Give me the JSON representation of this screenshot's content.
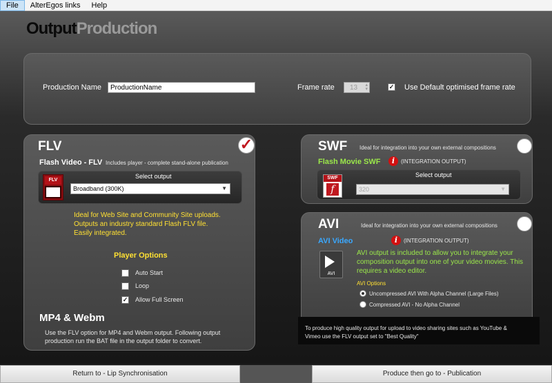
{
  "menu": {
    "items": [
      "File",
      "AlterEgos links",
      "Help"
    ]
  },
  "header": {
    "title_part1": "Output",
    "title_part2": "Production"
  },
  "top_panel": {
    "production_name_label": "Production Name",
    "production_name_value": "ProductionName",
    "frame_rate_label": "Frame rate",
    "frame_rate_value": "13",
    "use_default_label": "Use Default optimised frame rate"
  },
  "flv": {
    "title": "FLV",
    "subtitle": "Flash Video - FLV",
    "subtitle_note": "Includes player - complete stand-alone publication",
    "icon_label": "FLV",
    "select_output_label": "Select output",
    "select_output_value": "Broadband (300K)",
    "desc_line1": "Ideal for Web Site and Community Site uploads.",
    "desc_line2": "Outputs an industry standard Flash FLV file.",
    "desc_line3": "Easily integrated.",
    "player_options_title": "Player Options",
    "opt_auto_start": "Auto Start",
    "opt_loop": "Loop",
    "opt_full_screen": "Allow Full Screen",
    "mp4_title": "MP4 & Webm",
    "mp4_line1": "Use the FLV option for MP4 and Webm output. Following output",
    "mp4_line2": "production run the BAT file in the output folder to convert."
  },
  "swf": {
    "title": "SWF",
    "desc": "Ideal for integration into your own external compositions",
    "subtitle": "Flash Movie SWF",
    "integration": "(INTEGRATION OUTPUT)",
    "icon_label": "SWF",
    "select_output_label": "Select output",
    "select_output_value": "320"
  },
  "avi": {
    "title": "AVI",
    "desc": "Ideal for integration into your own external compositions",
    "subtitle": "AVI Video",
    "integration": "(INTEGRATION OUTPUT)",
    "icon_label": "AVI",
    "info_line1": "AVI output is included to allow you to integrate your",
    "info_line2": "composition output into one of your video movies. This",
    "info_line3": "requires a video editor.",
    "options_title": "AVI Options",
    "opt_uncompressed": "Uncompressed AVI With Alpha Channel (Large Files)",
    "opt_compressed": "Compressed AVI - No Alpha Channel"
  },
  "note": {
    "line1": "To produce high quality output for upload to video sharing sites such as YouTube &",
    "line2": "Vimeo use the FLV output set to \"Best Quality\""
  },
  "footer": {
    "back_label": "Return to - Lip Synchronisation",
    "forward_label": "Produce then go to - Publication"
  },
  "colors": {
    "accent_yellow": "#ffe033",
    "accent_green": "#9be84a",
    "accent_blue": "#3aa8ff",
    "check_red": "#c0181f"
  }
}
